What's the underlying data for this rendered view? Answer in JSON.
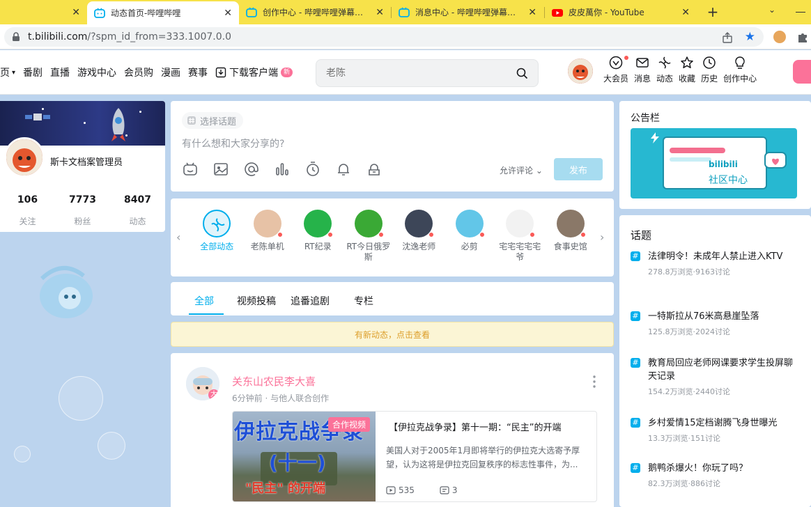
{
  "browser": {
    "tabs": [
      {
        "title": "动态首页-哔哩哔哩",
        "active": true
      },
      {
        "title": "创作中心 - 哔哩哔哩弹幕视频网",
        "active": false
      },
      {
        "title": "消息中心 - 哔哩哔哩弹幕视频网",
        "active": false
      },
      {
        "title": "皮皮萬你 - YouTube",
        "active": false
      }
    ],
    "url_host": "t.bilibili.com",
    "url_path": "/?spm_id_from=333.1007.0.0"
  },
  "header": {
    "nav": [
      "首页",
      "番剧",
      "直播",
      "游戏中心",
      "会员购",
      "漫画",
      "赛事",
      "下载客户端"
    ],
    "nav_new_badge": "新",
    "search_placeholder": "老陈",
    "right": [
      {
        "label": "大会员",
        "icon": "vip-icon"
      },
      {
        "label": "消息",
        "icon": "message-icon"
      },
      {
        "label": "动态",
        "icon": "dynamic-icon"
      },
      {
        "label": "收藏",
        "icon": "favorite-icon"
      },
      {
        "label": "历史",
        "icon": "history-icon"
      },
      {
        "label": "创作中心",
        "icon": "creator-icon"
      }
    ]
  },
  "profile": {
    "name": "斯卡文档案管理员",
    "stats": [
      {
        "value": "106",
        "label": "关注"
      },
      {
        "value": "7773",
        "label": "粉丝"
      },
      {
        "value": "8407",
        "label": "动态"
      }
    ]
  },
  "publish": {
    "topic": "选择话题",
    "placeholder": "有什么想和大家分享的?",
    "allow_comment": "允许评论",
    "submit": "发布"
  },
  "following": [
    {
      "name": "全部动态",
      "color": "#dff3fb"
    },
    {
      "name": "老陈单机",
      "color": "#e7c2a6"
    },
    {
      "name": "RT纪录",
      "color": "#26b34a"
    },
    {
      "name": "RT今日俄罗斯",
      "color": "#3aa935"
    },
    {
      "name": "沈逸老师",
      "color": "#3d4658"
    },
    {
      "name": "必剪",
      "color": "#62c6e8"
    },
    {
      "name": "宅宅宅宅宅爷",
      "color": "#f2f2f2"
    },
    {
      "name": "食事史馆",
      "color": "#8a7868"
    }
  ],
  "feed_tabs": [
    "全部",
    "视频投稿",
    "追番追剧",
    "专栏"
  ],
  "new_notice": "有新动态，点击查看",
  "post": {
    "author": "关东山农民李大喜",
    "level": "大",
    "meta": "6分钟前 · 与他人联合创作",
    "video": {
      "badge": "合作视频",
      "thumb_line1": "伊拉克战争录",
      "thumb_line2": "(十一)",
      "thumb_line3": "\"民主\" 的开端",
      "title": "【伊拉克战争录】第十一期：“民主”的开端",
      "desc": "美国人对于2005年1月即将举行的伊拉克大选寄予厚望，认为这将是伊拉克回复秩序的标志性事件，为...",
      "plays": "535",
      "danmaku": "3"
    }
  },
  "announce": {
    "title": "公告栏",
    "logo": "bilibili",
    "caption": "社区中心"
  },
  "topics": {
    "title": "话题",
    "items": [
      {
        "title": "法律明令！未成年人禁止进入KTV",
        "stat": "278.8万浏览·9163讨论"
      },
      {
        "title": "一特斯拉从76米高悬崖坠落",
        "stat": "125.8万浏览·2024讨论"
      },
      {
        "title": "教育局回应老师网课要求学生投屏聊天记录",
        "stat": "154.2万浏览·2440讨论"
      },
      {
        "title": "乡村爱情15定档谢腾飞身世曝光",
        "stat": "13.3万浏览·151讨论"
      },
      {
        "title": "鹅鸭杀爆火！你玩了吗？",
        "stat": "82.3万浏览·886讨论"
      }
    ]
  },
  "colors": {
    "accent": "#00aeec",
    "pink": "#fb7299",
    "tabbar": "#f7e24a"
  }
}
